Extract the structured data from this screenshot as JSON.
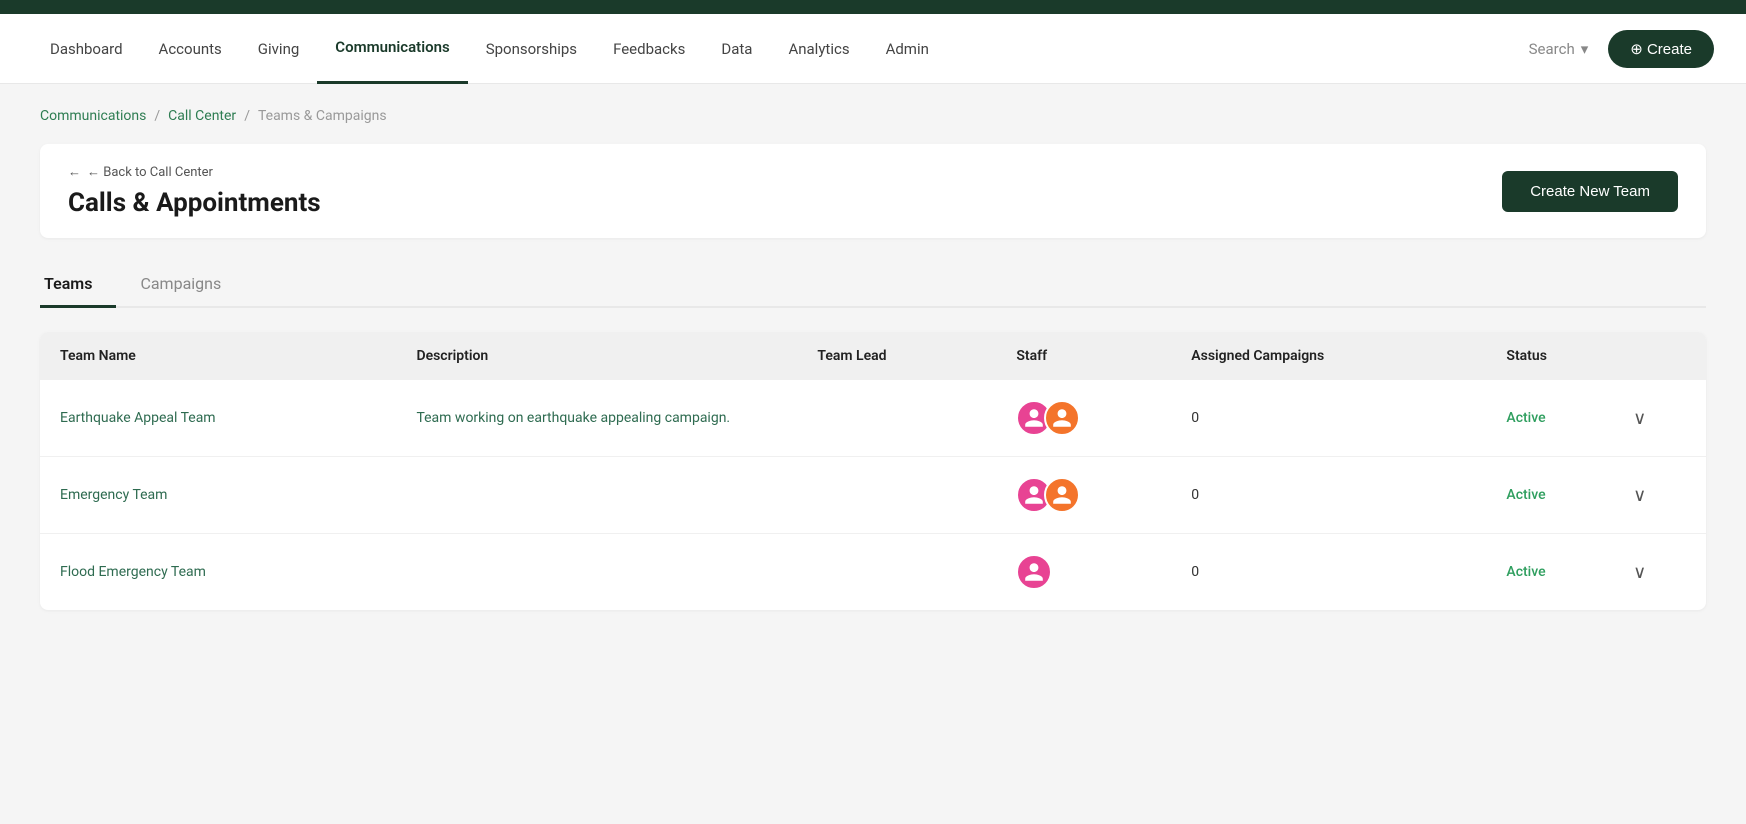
{
  "topbar": {},
  "navbar": {
    "items": [
      {
        "label": "Dashboard",
        "active": false
      },
      {
        "label": "Accounts",
        "active": false
      },
      {
        "label": "Giving",
        "active": false
      },
      {
        "label": "Communications",
        "active": true
      },
      {
        "label": "Sponsorships",
        "active": false
      },
      {
        "label": "Feedbacks",
        "active": false
      },
      {
        "label": "Data",
        "active": false
      },
      {
        "label": "Analytics",
        "active": false
      },
      {
        "label": "Admin",
        "active": false
      }
    ],
    "search_label": "Search",
    "create_label": "⊕ Create"
  },
  "breadcrumb": {
    "links": [
      "Communications",
      "Call Center"
    ],
    "current": "Teams & Campaigns",
    "sep": "/"
  },
  "page": {
    "back_label": "← Back to Call Center",
    "title": "Calls & Appointments",
    "create_team_btn": "Create New Team"
  },
  "tabs": [
    {
      "label": "Teams",
      "active": true
    },
    {
      "label": "Campaigns",
      "active": false
    }
  ],
  "table": {
    "columns": [
      "Team Name",
      "Description",
      "Team Lead",
      "Staff",
      "Assigned Campaigns",
      "Status"
    ],
    "rows": [
      {
        "team_name": "Earthquake Appeal Team",
        "description": "Team working on earthquake appealing campaign.",
        "team_lead": "",
        "staff_count": 2,
        "staff_avatars": [
          "pink",
          "orange"
        ],
        "assigned_campaigns": "0",
        "status": "Active"
      },
      {
        "team_name": "Emergency Team",
        "description": "",
        "team_lead": "",
        "staff_count": 2,
        "staff_avatars": [
          "pink",
          "orange"
        ],
        "assigned_campaigns": "0",
        "status": "Active"
      },
      {
        "team_name": "Flood Emergency Team",
        "description": "",
        "team_lead": "",
        "staff_count": 1,
        "staff_avatars": [
          "pink"
        ],
        "assigned_campaigns": "0",
        "status": "Active"
      }
    ]
  },
  "colors": {
    "green_dark": "#1a3a2a",
    "green_accent": "#2e7d52",
    "avatar_pink": "#e84393",
    "avatar_orange": "#f4742b"
  }
}
